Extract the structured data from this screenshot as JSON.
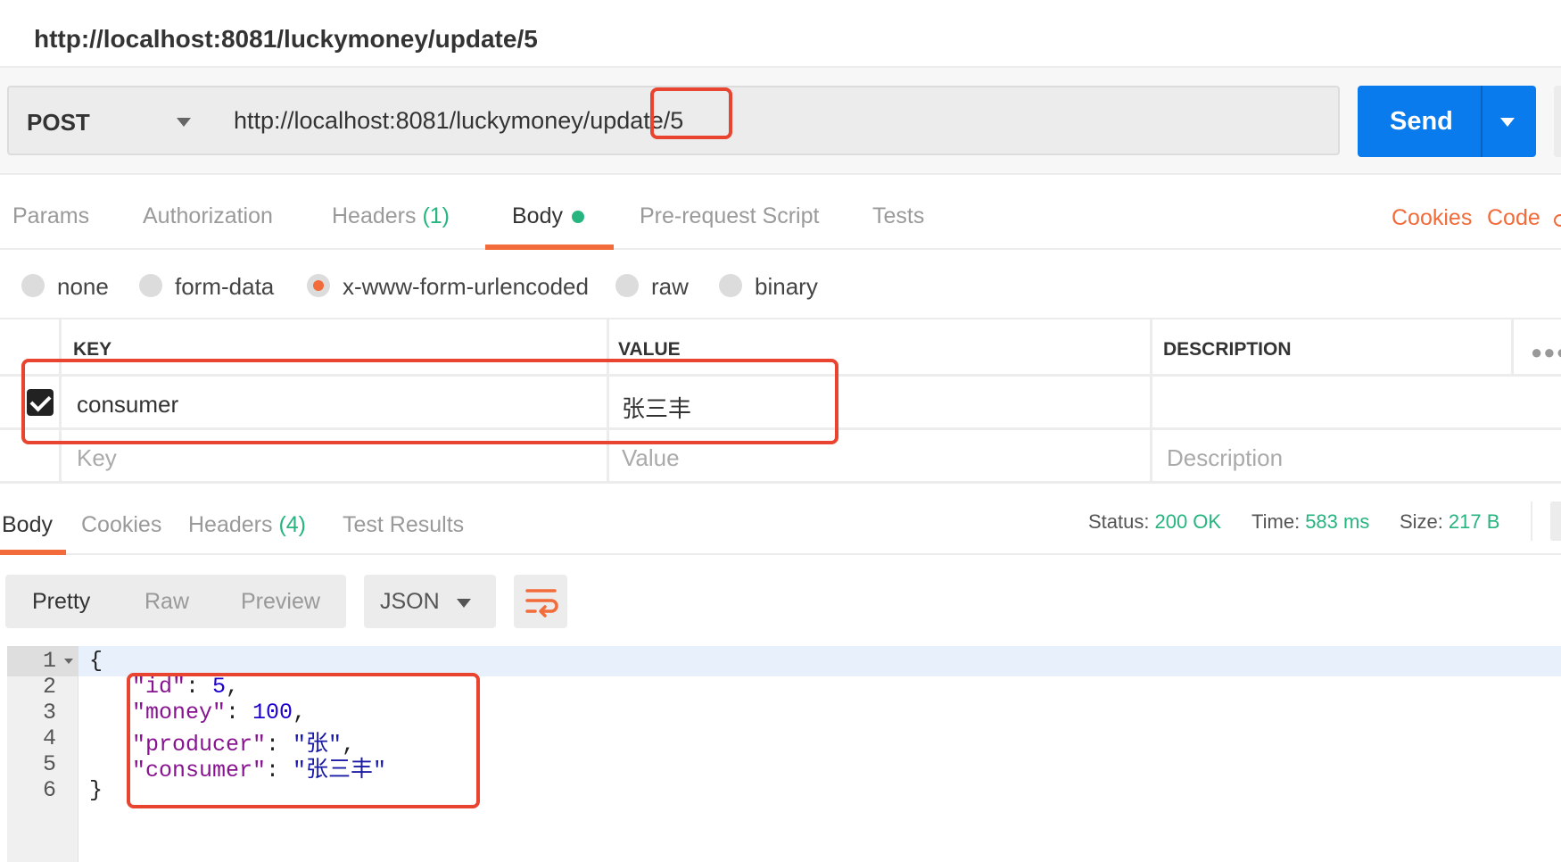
{
  "window": {
    "title": "http://localhost:8081/luckymoney/update/5"
  },
  "request": {
    "method": "POST",
    "url": "http://localhost:8081/luckymoney/update/5",
    "send_label": "Send"
  },
  "request_tabs": [
    {
      "label": "Params"
    },
    {
      "label": "Authorization"
    },
    {
      "label": "Headers",
      "count": "(1)"
    },
    {
      "label": "Body"
    },
    {
      "label": "Pre-request Script"
    },
    {
      "label": "Tests"
    }
  ],
  "right_links": {
    "cookies": "Cookies",
    "code": "Code"
  },
  "body_types": [
    {
      "label": "none",
      "selected": false
    },
    {
      "label": "form-data",
      "selected": false
    },
    {
      "label": "x-www-form-urlencoded",
      "selected": true
    },
    {
      "label": "raw",
      "selected": false
    },
    {
      "label": "binary",
      "selected": false
    }
  ],
  "kv_table": {
    "headers": {
      "key": "KEY",
      "value": "VALUE",
      "description": "DESCRIPTION"
    },
    "rows": [
      {
        "checked": true,
        "key": "consumer",
        "value": "张三丰",
        "description": ""
      }
    ],
    "placeholders": {
      "key": "Key",
      "value": "Value",
      "description": "Description"
    }
  },
  "response_tabs": [
    {
      "label": "Body"
    },
    {
      "label": "Cookies"
    },
    {
      "label": "Headers",
      "count": "(4)"
    },
    {
      "label": "Test Results"
    }
  ],
  "response_meta": {
    "status_label": "Status:",
    "status": "200 OK",
    "time_label": "Time:",
    "time": "583 ms",
    "size_label": "Size:",
    "size": "217 B"
  },
  "format": {
    "modes": [
      "Pretty",
      "Raw",
      "Preview"
    ],
    "active_mode": "Pretty",
    "language": "JSON"
  },
  "response_body": {
    "line_numbers": [
      "1",
      "2",
      "3",
      "4",
      "5",
      "6"
    ],
    "open_brace": "{",
    "close_brace": "}",
    "fields": [
      {
        "key": "\"id\"",
        "value": "5",
        "sep": ","
      },
      {
        "key": "\"money\"",
        "value": "100",
        "sep": ","
      },
      {
        "key": "\"producer\"",
        "value": "\"张\"",
        "sep": ","
      },
      {
        "key": "\"consumer\"",
        "value": "\"张三丰\"",
        "sep": ""
      }
    ]
  },
  "colors": {
    "accent": "#f26b3a",
    "send": "#097bed",
    "success": "#26b47f",
    "annotation": "#e8442f"
  }
}
